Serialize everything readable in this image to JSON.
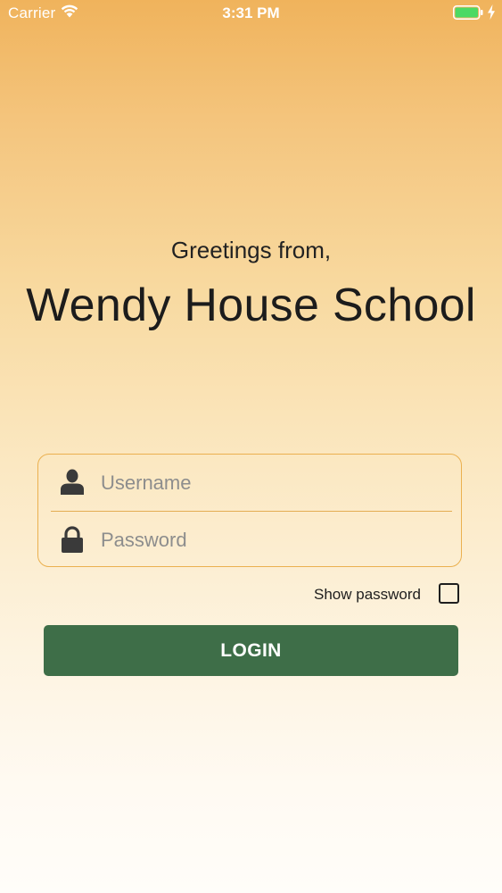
{
  "status_bar": {
    "carrier": "Carrier",
    "time": "3:31 PM",
    "icons": [
      "wifi-icon",
      "battery-icon",
      "charging-icon"
    ],
    "battery_color": "#4cd964"
  },
  "header": {
    "greeting": "Greetings from,",
    "school_name": "Wendy House School"
  },
  "login_form": {
    "username": {
      "placeholder": "Username",
      "value": "",
      "icon": "user-icon"
    },
    "password": {
      "placeholder": "Password",
      "value": "",
      "icon": "lock-icon"
    },
    "show_password_label": "Show password",
    "show_password_checked": false,
    "login_label": "LOGIN"
  },
  "colors": {
    "gradient_top": "#f0b35c",
    "gradient_bottom": "#fffdf9",
    "card_border": "#ebb04f",
    "button": "#3e6e48",
    "icon": "#3a3a3a"
  }
}
